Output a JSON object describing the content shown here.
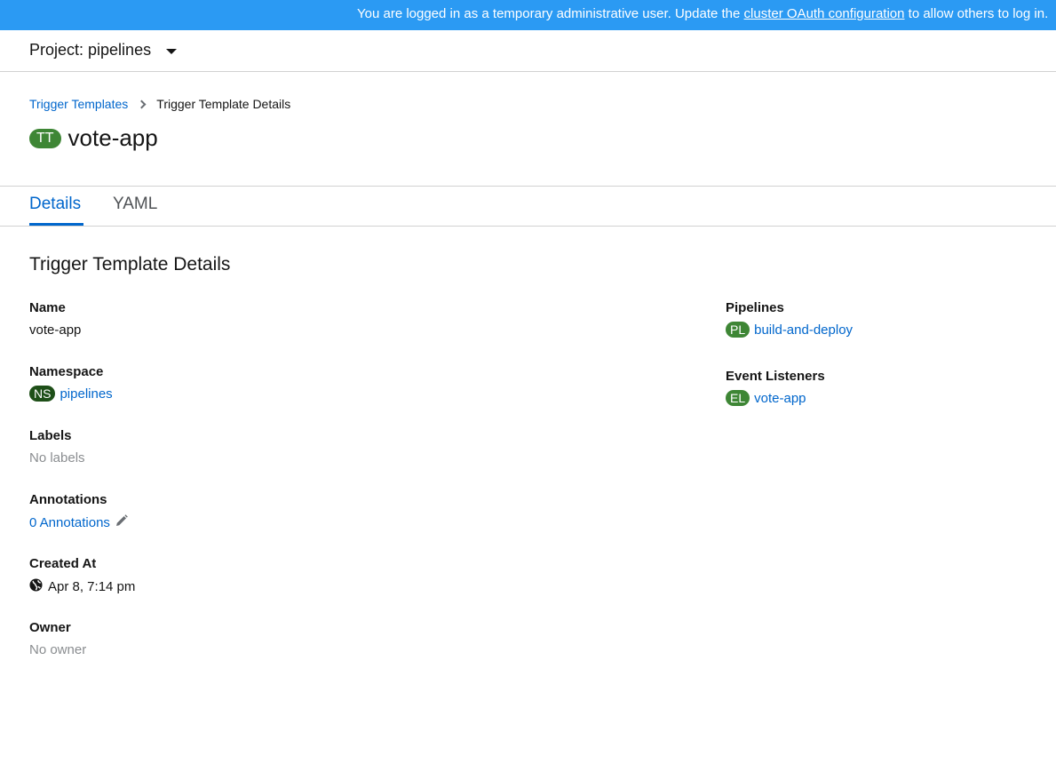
{
  "banner": {
    "text_before": "You are logged in as a temporary administrative user. Update the ",
    "link_text": "cluster OAuth configuration",
    "text_after": " to allow others to log in."
  },
  "project": {
    "label": "Project: pipelines",
    "caret_icon": "caret-down-icon"
  },
  "breadcrumb": {
    "parent": "Trigger Templates",
    "current": "Trigger Template Details"
  },
  "header": {
    "badge": "TT",
    "title": "vote-app"
  },
  "tabs": [
    {
      "label": "Details",
      "active": true
    },
    {
      "label": "YAML",
      "active": false
    }
  ],
  "details": {
    "heading": "Trigger Template Details",
    "name": {
      "label": "Name",
      "value": "vote-app"
    },
    "namespace": {
      "label": "Namespace",
      "badge": "NS",
      "value": "pipelines"
    },
    "labels": {
      "label": "Labels",
      "value": "No labels"
    },
    "annotations": {
      "label": "Annotations",
      "value": "0 Annotations",
      "icon": "pencil-icon"
    },
    "created_at": {
      "label": "Created At",
      "icon": "globe-icon",
      "value": "Apr 8, 7:14 pm"
    },
    "owner": {
      "label": "Owner",
      "value": "No owner"
    },
    "pipelines": {
      "label": "Pipelines",
      "badge": "PL",
      "value": "build-and-deploy"
    },
    "event_listeners": {
      "label": "Event Listeners",
      "badge": "EL",
      "value": "vote-app"
    }
  },
  "colors": {
    "banner": "#2b9af3",
    "link": "#0066cc",
    "badge_green": "#3e8635",
    "badge_ns": "#1e4f18"
  }
}
